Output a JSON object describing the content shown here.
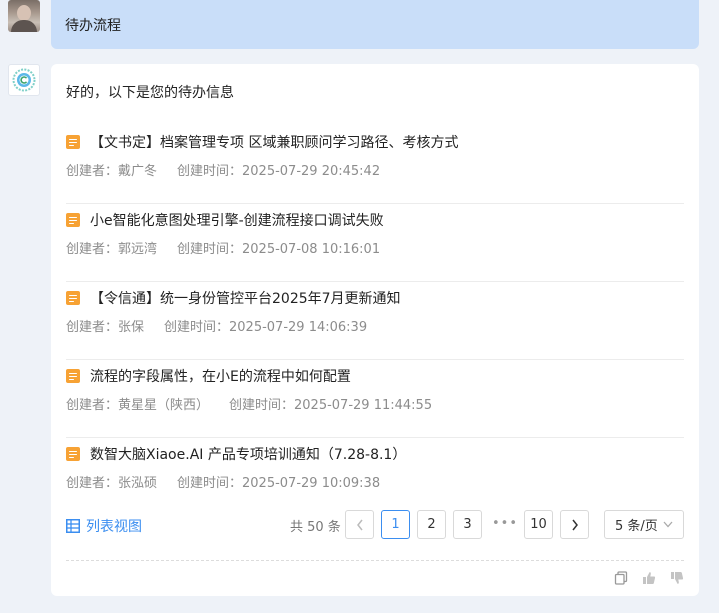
{
  "user_message": "待办流程",
  "assistant": {
    "intro": "好的，以下是您的待办信息",
    "items": [
      {
        "title": "【文书定】档案管理专项 区域兼职顾问学习路径、考核方式",
        "creator": "创建者：戴广冬",
        "created": "创建时间：2025-07-29 20:45:42"
      },
      {
        "title": "小e智能化意图处理引擎-创建流程接口调试失败",
        "creator": "创建者：郭远湾",
        "created": "创建时间：2025-07-08 10:16:01"
      },
      {
        "title": "【令信通】统一身份管控平台2025年7月更新通知",
        "creator": "创建者：张保",
        "created": "创建时间：2025-07-29 14:06:39"
      },
      {
        "title": "流程的字段属性，在小E的流程中如何配置",
        "creator": "创建者：黄星星（陕西）",
        "created": "创建时间：2025-07-29 11:44:55"
      },
      {
        "title": "数智大脑Xiaoe.AI 产品专项培训通知（7.28-8.1）",
        "creator": "创建者：张泓硕",
        "created": "创建时间：2025-07-29 10:09:38"
      }
    ],
    "list_view_label": "列表视图",
    "pagination": {
      "total": "共 50 条",
      "pages": [
        "1",
        "2",
        "3",
        "10"
      ],
      "current": "1",
      "ellipsis": "•••",
      "page_size": "5 条/页"
    }
  },
  "colors": {
    "accent": "#3b8ef0",
    "user_bubble": "#c9def9",
    "doc_icon": "#f7a234",
    "background": "#eef2f8"
  },
  "icons": {
    "item": "document-icon",
    "list_view": "table-icon",
    "copy": "copy-icon",
    "like": "thumbs-up-icon",
    "dislike": "thumbs-down-icon"
  }
}
